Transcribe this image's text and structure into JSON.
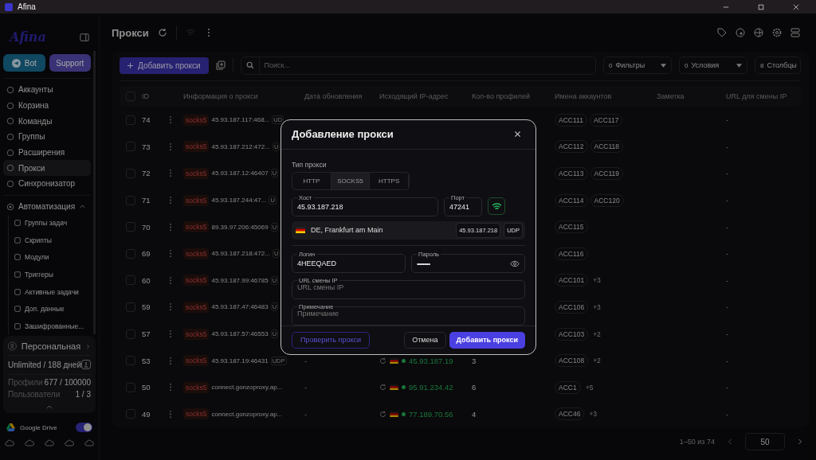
{
  "window": {
    "title": "Afina"
  },
  "sidebar": {
    "logo": "Afina",
    "bot_button": "Bot",
    "support_button": "Support",
    "items": [
      {
        "label": "Аккаунты",
        "selected": false
      },
      {
        "label": "Корзина",
        "selected": false
      },
      {
        "label": "Команды",
        "selected": false
      },
      {
        "label": "Группы",
        "selected": false
      },
      {
        "label": "Расширения",
        "selected": false
      },
      {
        "label": "Прокси",
        "selected": true
      },
      {
        "label": "Синхронизатор",
        "selected": false
      }
    ],
    "automation": {
      "label": "Автоматизация",
      "expanded": true,
      "children": [
        {
          "label": "Группы задач"
        },
        {
          "label": "Скрипты"
        },
        {
          "label": "Модули"
        },
        {
          "label": "Триггеры"
        },
        {
          "label": "Активные задачи"
        },
        {
          "label": "Доп. данные"
        },
        {
          "label": "Зашифрованные..."
        }
      ]
    },
    "plan": {
      "name": "Персональная",
      "term": "Unlimited / 188 дней",
      "stats": [
        {
          "label": "Профили",
          "value": "677 / 100000"
        },
        {
          "label": "Пользователи",
          "value": "1 / 3"
        }
      ]
    },
    "drive": {
      "label": "Google Drive",
      "on": true
    }
  },
  "page": {
    "title": "Прокси"
  },
  "toolbar": {
    "add_button": "Добавить прокси",
    "search_placeholder": "Поиск...",
    "filters": [
      {
        "count": "0",
        "label": "Фильтры"
      },
      {
        "count": "0",
        "label": "Условия"
      }
    ],
    "columns_button": {
      "count": "8",
      "label": "Столбцы"
    }
  },
  "table": {
    "columns": [
      "ID",
      "Информация о прокси",
      "Дата обновления",
      "Исходящий IP-адрес",
      "Кол-во профилей",
      "Имена аккаунтов",
      "Заметка",
      "URL для смены IP"
    ],
    "select_all_checked": false,
    "rows": [
      {
        "id": "74",
        "checked": false,
        "type": "socks5",
        "address": "45.93.187.117:468...",
        "badge": "UD",
        "accounts": [
          "ACC111",
          "ACC117"
        ],
        "url": "-"
      },
      {
        "id": "73",
        "checked": false,
        "type": "socks5",
        "address": "45.93.187.212:472...",
        "badge": "U",
        "accounts": [
          "ACC112",
          "ACC118"
        ],
        "url": "-"
      },
      {
        "id": "72",
        "checked": false,
        "type": "socks5",
        "address": "45.93.187.12:46407",
        "badge": "U",
        "accounts": [
          "ACC113",
          "ACC119"
        ],
        "url": "-"
      },
      {
        "id": "71",
        "checked": false,
        "type": "socks5",
        "address": "45.93.187.244:47...",
        "badge": "U",
        "accounts": [
          "ACC114",
          "ACC120"
        ],
        "url": "-"
      },
      {
        "id": "70",
        "checked": false,
        "type": "socks5",
        "address": "89.39.97.206:45069",
        "badge": "U",
        "accounts": [
          "ACC115"
        ],
        "url": "-"
      },
      {
        "id": "69",
        "checked": false,
        "type": "socks5",
        "address": "45.93.187.218:472...",
        "badge": "U",
        "accounts": [
          "ACC116"
        ],
        "url": "-"
      },
      {
        "id": "60",
        "checked": false,
        "type": "socks5",
        "address": "45.93.187.99:46785",
        "badge": "U",
        "accounts": [
          "ACC101"
        ],
        "more": "+3",
        "url": "-"
      },
      {
        "id": "59",
        "checked": false,
        "type": "socks5",
        "address": "45.93.187.47:46483",
        "badge": "U",
        "accounts": [
          "ACC106"
        ],
        "more": "+3",
        "url": "-"
      },
      {
        "id": "57",
        "checked": false,
        "type": "socks5",
        "address": "45.93.187.57:46553",
        "badge": "U",
        "accounts": [
          "ACC103"
        ],
        "more": "+2",
        "url": "-"
      },
      {
        "id": "53",
        "checked": false,
        "type": "socks5",
        "address": "45.93.187.19:46431",
        "badge": "UDP",
        "updated": "-",
        "ip": "45.93.187.19",
        "profiles": "3",
        "accounts": [
          "ACC108"
        ],
        "more": "+2",
        "url": "-"
      },
      {
        "id": "50",
        "checked": false,
        "type": "socks5",
        "address": "connect.gonzoproxy.ap...",
        "updated": "-",
        "ip": "95.91.234.42",
        "profiles": "6",
        "accounts": [
          "ACC1"
        ],
        "more": "+5",
        "url": "-"
      },
      {
        "id": "49",
        "checked": false,
        "type": "socks5",
        "address": "connect.gonzoproxy.ap...",
        "updated": "-",
        "ip": "77.189.70.56",
        "profiles": "4",
        "accounts": [
          "ACC46"
        ],
        "more": "+3",
        "url": "-"
      }
    ]
  },
  "pagination": {
    "range": "1–50 из 74",
    "page_size": "50"
  },
  "dialog": {
    "title": "Добавление прокси",
    "type_label": "Тип прокси",
    "types": [
      {
        "label": "HTTP",
        "selected": false
      },
      {
        "label": "SOCKS5",
        "selected": true
      },
      {
        "label": "HTTPS",
        "selected": false
      }
    ],
    "host": {
      "label": "Хост",
      "value": "45.93.187.218"
    },
    "port": {
      "label": "Порт",
      "value": "47241"
    },
    "location": {
      "text": "DE, Frankfurt am Main",
      "ip": "45.93.187.218",
      "protocol": "UDP"
    },
    "login": {
      "label": "Логин",
      "value": "4HEEQAED"
    },
    "password": {
      "label": "Пароль",
      "mask": "•••••••••"
    },
    "url": {
      "label": "URL смены IP",
      "placeholder": "URL смены IP"
    },
    "note": {
      "label": "Примечание",
      "placeholder": "Примечание"
    },
    "check_button": "Проверить прокси",
    "cancel_button": "Отмена",
    "submit_button": "Добавить прокси"
  }
}
